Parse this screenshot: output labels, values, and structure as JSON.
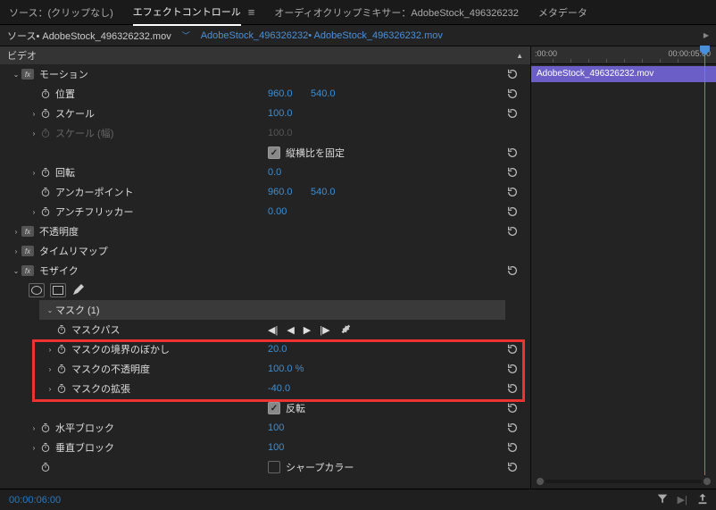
{
  "tabs": {
    "source": "ソース：(クリップなし)",
    "effectControls": "エフェクトコントロール",
    "audioMixer": "オーディオクリップミキサー：AdobeStock_496326232",
    "metadata": "メタデータ"
  },
  "subheader": {
    "source": "ソース• AdobeStock_496326232.mov",
    "sequence": "AdobeStock_496326232• AdobeStock_496326232.mov"
  },
  "videoSectionLabel": "ビデオ",
  "motion": {
    "label": "モーション",
    "position": {
      "label": "位置",
      "x": "960.0",
      "y": "540.0"
    },
    "scale": {
      "label": "スケール",
      "value": "100.0"
    },
    "scaleW": {
      "label": "スケール (幅)",
      "value": "100.0"
    },
    "uniform": {
      "label": "縦横比を固定",
      "checked": true
    },
    "rotation": {
      "label": "回転",
      "value": "0.0"
    },
    "anchor": {
      "label": "アンカーポイント",
      "x": "960.0",
      "y": "540.0"
    },
    "antiflicker": {
      "label": "アンチフリッカー",
      "value": "0.00"
    }
  },
  "opacity": {
    "label": "不透明度"
  },
  "timeremap": {
    "label": "タイムリマップ"
  },
  "mosaic": {
    "label": "モザイク",
    "maskName": "マスク (1)",
    "maskPath": {
      "label": "マスクパス"
    },
    "maskFeather": {
      "label": "マスクの境界のぼかし",
      "value": "20.0"
    },
    "maskOpacity": {
      "label": "マスクの不透明度",
      "value": "100.0 %"
    },
    "maskExpansion": {
      "label": "マスクの拡張",
      "value": "-40.0"
    },
    "inverted": {
      "label": "反転",
      "checked": true
    },
    "hBlocks": {
      "label": "水平ブロック",
      "value": "100"
    },
    "vBlocks": {
      "label": "垂直ブロック",
      "value": "100"
    },
    "sharpColor": {
      "label": "シャープカラー",
      "checked": false
    }
  },
  "timeline": {
    "start": ":00:00",
    "end": "00:00:05:00",
    "clipName": "AdobeStock_496326232.mov"
  },
  "footer": {
    "timecode": "00:00:06:00"
  }
}
